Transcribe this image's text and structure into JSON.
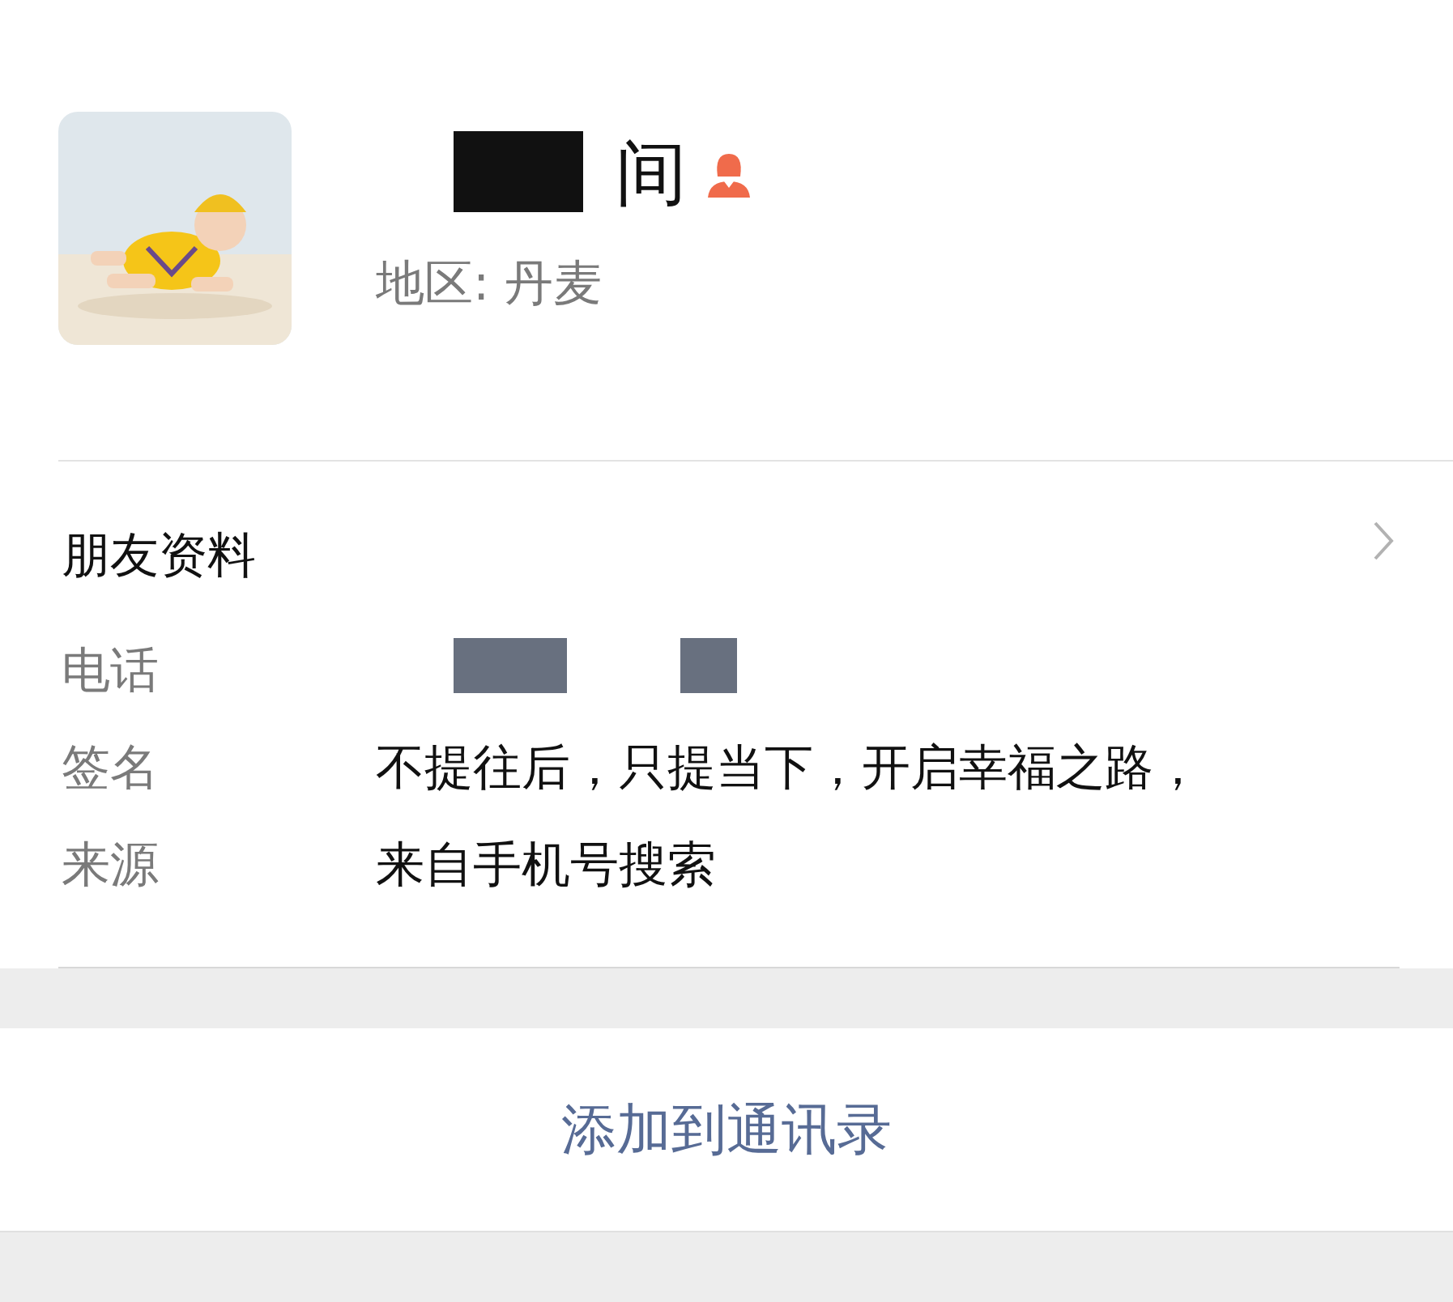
{
  "profile": {
    "name": "间",
    "region": "地区:  丹麦"
  },
  "section": {
    "title": "朋友资料"
  },
  "fields": [
    {
      "label": "电话",
      "kind": "hidden"
    },
    {
      "label": "签名",
      "kind": "text",
      "value": "不提往后，只提当下，开启幸福之路，"
    },
    {
      "label": "来源",
      "kind": "text",
      "value": "来自手机号搜索"
    }
  ],
  "action": {
    "label": "添加到通讯录"
  }
}
